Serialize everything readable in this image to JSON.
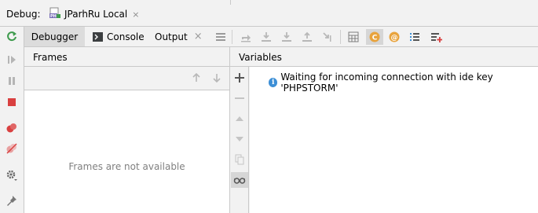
{
  "header": {
    "debug_label": "Debug:",
    "run_config": {
      "label": "JParhRu Local",
      "icon": "php-run-icon",
      "close": "×"
    }
  },
  "tabs": [
    {
      "label": "Debugger",
      "active": true
    },
    {
      "label": "Console",
      "icon": "console-icon"
    },
    {
      "label": "Output",
      "close": "×"
    }
  ],
  "left_toolbar": [
    "rerun-icon",
    "resume-icon",
    "pause-icon",
    "stop-icon",
    "view-breakpoints-icon",
    "mute-breakpoints-icon",
    "settings-icon",
    "pin-icon"
  ],
  "debug_toolbar": [
    "layout-icon",
    "show-execution-point-icon",
    "step-over-icon",
    "step-into-icon",
    "force-step-into-icon",
    "step-out-icon",
    "run-to-cursor-icon",
    "evaluate-expression-icon",
    "php-class-icon",
    "at-icon",
    "list-icon",
    "add-watch-list-icon"
  ],
  "frames": {
    "title": "Frames",
    "empty_text": "Frames are not available"
  },
  "variables": {
    "title": "Variables",
    "message": "Waiting for incoming connection with ide key 'PHPSTORM'"
  },
  "colors": {
    "background": "#f2f2f2",
    "panel": "#ffffff",
    "border": "#c9c9c9",
    "accent_blue": "#3d8fd6",
    "stop_red": "#d94040",
    "run_green": "#3e9b4d",
    "highlight_orange": "#e8a33d"
  }
}
